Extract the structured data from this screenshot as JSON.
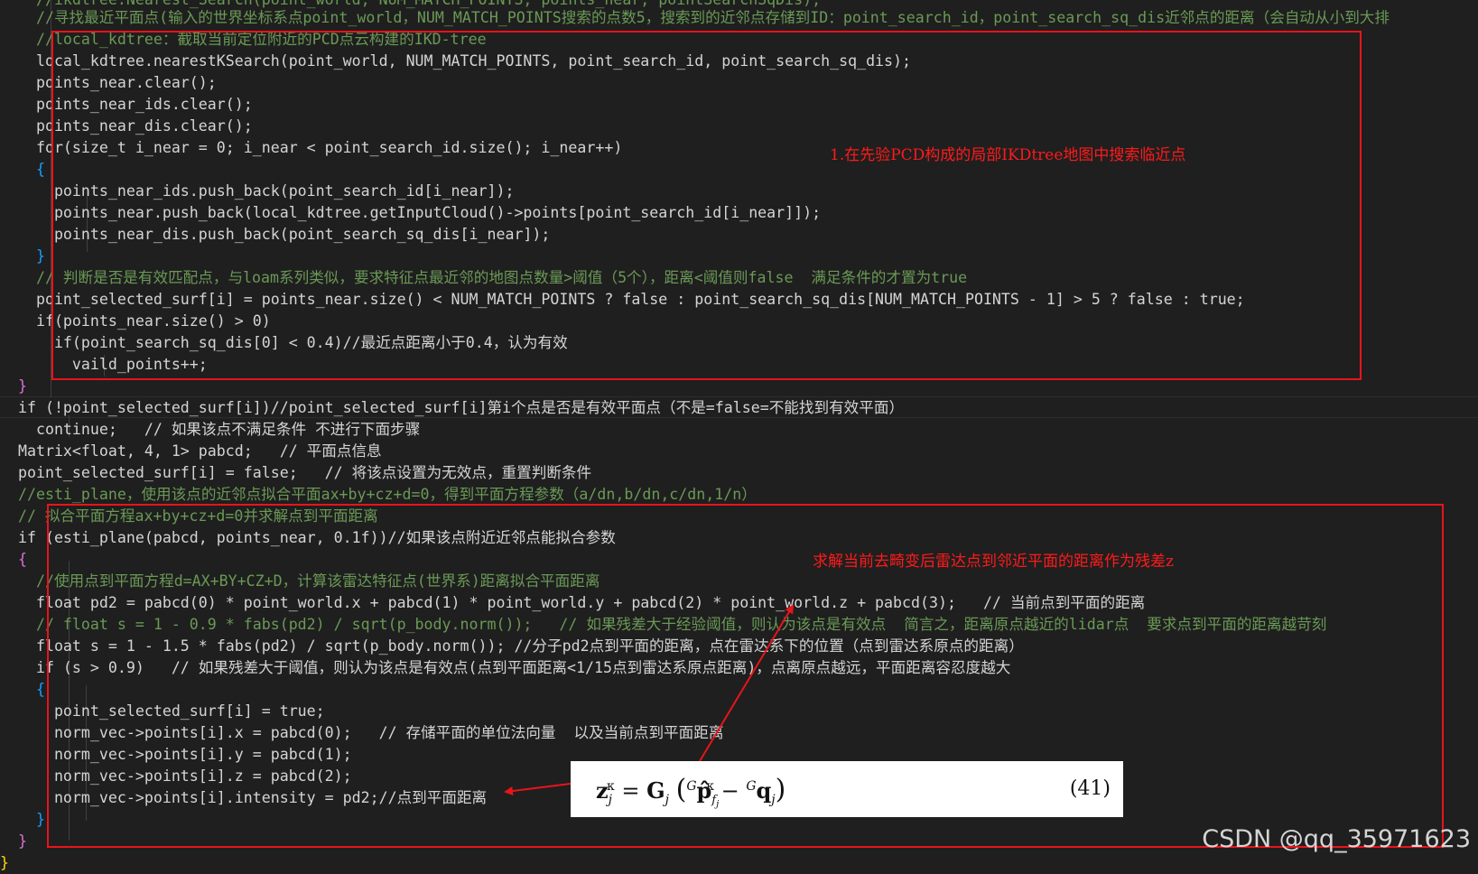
{
  "code_lines": [
    "    //ikdtree.Nearest_Search(point_world, NUM_MATCH_POINTS, points_near, pointSearchSqDis);",
    "    //寻找最近平面点(输入的世界坐标系点point_world，NUM_MATCH_POINTS搜索的点数5，搜索到的近邻点存储到ID：point_search_id，point_search_sq_dis近邻点的距离（会自动从小到大排",
    "    //local_kdtree：截取当前定位附近的PCD点云构建的IKD-tree",
    "    local_kdtree.nearestKSearch(point_world, NUM_MATCH_POINTS, point_search_id, point_search_sq_dis);",
    "    points_near.clear();",
    "    points_near_ids.clear();",
    "    points_near_dis.clear();",
    "    for(size_t i_near = 0; i_near < point_search_id.size(); i_near++)",
    "    {",
    "      points_near_ids.push_back(point_search_id[i_near]);",
    "      points_near.push_back(local_kdtree.getInputCloud()->points[point_search_id[i_near]]);",
    "      points_near_dis.push_back(point_search_sq_dis[i_near]);",
    "    }",
    "    // 判断是否是有效匹配点，与loam系列类似，要求特征点最近邻的地图点数量>阈值（5个），距离<阈值则false  满足条件的才置为true",
    "    point_selected_surf[i] = points_near.size() < NUM_MATCH_POINTS ? false : point_search_sq_dis[NUM_MATCH_POINTS - 1] > 5 ? false : true;",
    "    if(points_near.size() > 0)",
    "      if(point_search_sq_dis[0] < 0.4)//最近点距离小于0.4，认为有效",
    "        vaild_points++;",
    "  }",
    "  if (!point_selected_surf[i])//point_selected_surf[i]第i个点是否是有效平面点（不是=false=不能找到有效平面）",
    "    continue;   // 如果该点不满足条件 不进行下面步骤",
    "  Matrix<float, 4, 1> pabcd;   // 平面点信息",
    "  point_selected_surf[i] = false;   // 将该点设置为无效点，重置判断条件",
    "  //esti_plane，使用该点的近邻点拟合平面ax+by+cz+d=0，得到平面方程参数（a/dn,b/dn,c/dn,1/n）",
    "  // 拟合平面方程ax+by+cz+d=0并求解点到平面距离",
    "  if (esti_plane(pabcd, points_near, 0.1f))//如果该点附近近邻点能拟合参数",
    "  {",
    "    //使用点到平面方程d=AX+BY+CZ+D，计算该雷达特征点(世界系)距离拟合平面距离",
    "    float pd2 = pabcd(0) * point_world.x + pabcd(1) * point_world.y + pabcd(2) * point_world.z + pabcd(3);   // 当前点到平面的距离",
    "    // float s = 1 - 0.9 * fabs(pd2) / sqrt(p_body.norm());   // 如果残差大于经验阈值，则认为该点是有效点  简言之，距离原点越近的lidar点  要求点到平面的距离越苛刻",
    "    float s = 1 - 1.5 * fabs(pd2) / sqrt(p_body.norm()); //分子pd2点到平面的距离，点在雷达系下的位置（点到雷达系原点的距离）",
    "    if (s > 0.9)   // 如果残差大于阈值，则认为该点是有效点(点到平面距离<1/15点到雷达系原点距离)，点离原点越远，平面距离容忍度越大",
    "    {",
    "      point_selected_surf[i] = true;",
    "      norm_vec->points[i].x = pabcd(0);   // 存储平面的单位法向量  以及当前点到平面距离",
    "      norm_vec->points[i].y = pabcd(1);",
    "      norm_vec->points[i].z = pabcd(2);",
    "      norm_vec->points[i].intensity = pd2;//点到平面距离",
    "    }",
    "  }",
    "}"
  ],
  "annotations": {
    "box1_label": "1.在先验PCD构成的局部IKDtree地图中搜索临近点",
    "box2_label": "求解当前去畸变后雷达点到邻近平面的距离作为残差z"
  },
  "formula": {
    "equation": "z_j^κ = G_j ( ^G p̂_{f_j}^κ − ^G q_j )",
    "number": "(41)"
  },
  "watermark": "CSDN @qq_35971623",
  "colors": {
    "background": "#1f1f1f",
    "box": "#e8141b",
    "annotation": "#ff1a1a",
    "comment": "#6a9955",
    "keyword": "#569cd6"
  }
}
